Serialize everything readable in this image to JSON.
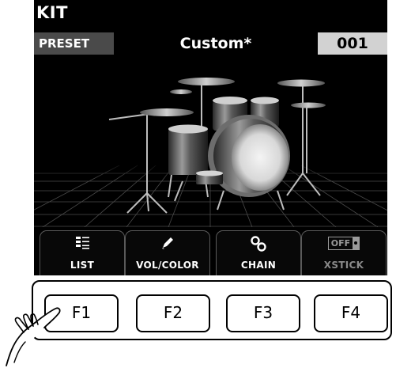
{
  "header": {
    "title": "KIT"
  },
  "preset": {
    "label": "PRESET",
    "name": "Custom*",
    "number": "001"
  },
  "function_tabs": [
    {
      "label": "LIST",
      "icon": "list-icon"
    },
    {
      "label": "VOL/COLOR",
      "icon": "pencil-icon"
    },
    {
      "label": "CHAIN",
      "icon": "chain-icon"
    },
    {
      "label": "XSTICK",
      "icon": "toggle-icon",
      "state": "OFF"
    }
  ],
  "hardware_buttons": [
    "F1",
    "F2",
    "F3",
    "F4"
  ],
  "colors": {
    "screen_bg": "#000000",
    "preset_label_bg": "#4a4a4a",
    "preset_number_bg": "#d2d2d2"
  }
}
